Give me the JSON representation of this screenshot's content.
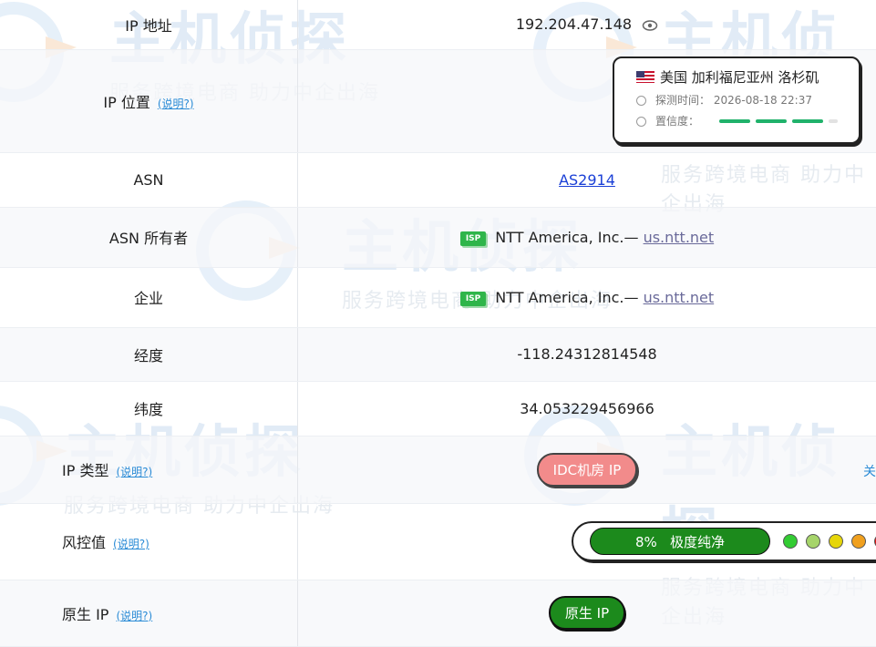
{
  "watermark": {
    "logo": "主机侦探",
    "slogan": "服务跨境电商 助力中企出海"
  },
  "rows": {
    "ip_address": {
      "label": "IP 地址",
      "value": "192.204.47.148",
      "icon": "eye-icon"
    },
    "ip_location": {
      "label": "IP 位置",
      "help": "(说明?)",
      "country_flag": "us-flag-icon",
      "location": "美国 加利福尼亚州 洛杉矶",
      "probe_label": "探测时间：",
      "probe_time": "2026-08-18 22:37",
      "confidence_label": "置信度：",
      "confidence_level": 3,
      "confidence_max": 4
    },
    "asn": {
      "label": "ASN",
      "value": "AS2914"
    },
    "asn_owner": {
      "label": "ASN 所有者",
      "badge": "ISP",
      "name": "NTT America, Inc.—",
      "domain": "us.ntt.net"
    },
    "company": {
      "label": "企业",
      "badge": "ISP",
      "name": "NTT America, Inc.—",
      "domain": "us.ntt.net"
    },
    "longitude": {
      "label": "经度",
      "value": "-118.24312814548"
    },
    "latitude": {
      "label": "纬度",
      "value": "34.053229456966"
    },
    "ip_type": {
      "label": "IP 类型",
      "help": "(说明?)",
      "value": "IDC机房 IP",
      "edge_text": "关"
    },
    "risk": {
      "label": "风控值",
      "help": "(说明?)",
      "percent": "8%",
      "text": "极度纯净",
      "level_colors": [
        "#33cc33",
        "#a6d46a",
        "#e6d60a",
        "#f0a01e",
        "#e61010"
      ]
    },
    "native_ip": {
      "label": "原生 IP",
      "help": "(说明?)",
      "value": "原生 IP"
    }
  },
  "colors": {
    "green": "#1c8a1c",
    "idc_red": "#f28b8b",
    "link": "#1a3fd6",
    "help": "#2a8bd6"
  }
}
